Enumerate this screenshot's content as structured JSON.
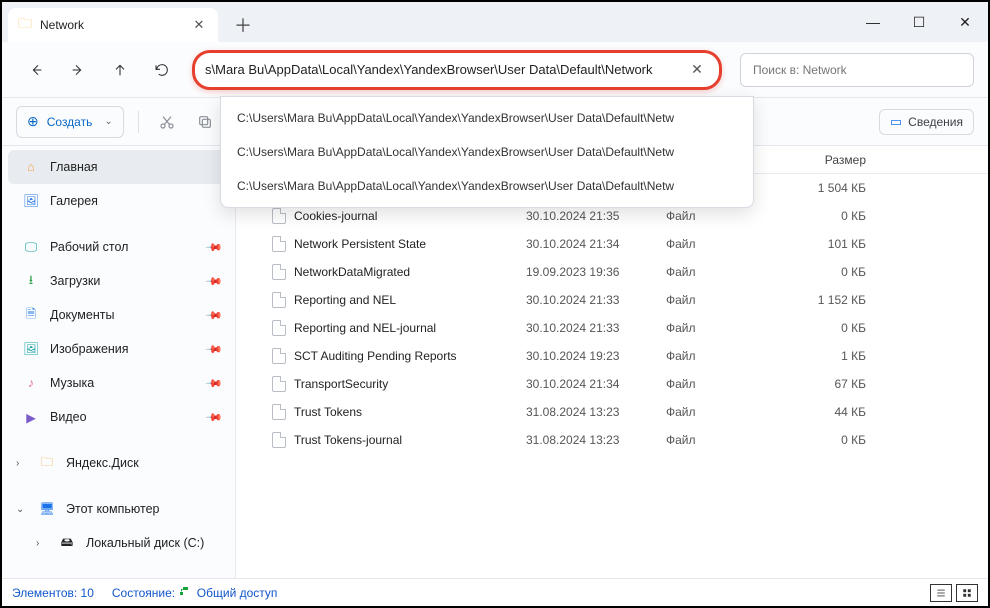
{
  "window": {
    "tab_title": "Network"
  },
  "nav": {
    "address_value": "s\\Mara Bu\\AppData\\Local\\Yandex\\YandexBrowser\\User Data\\Default\\Network",
    "search_placeholder": "Поиск в: Network"
  },
  "suggestions": [
    "C:\\Users\\Mara Bu\\AppData\\Local\\Yandex\\YandexBrowser\\User Data\\Default\\Netw",
    "C:\\Users\\Mara Bu\\AppData\\Local\\Yandex\\YandexBrowser\\User Data\\Default\\Netw",
    "C:\\Users\\Mara Bu\\AppData\\Local\\Yandex\\YandexBrowser\\User Data\\Default\\Netw"
  ],
  "toolbar": {
    "create_label": "Создать",
    "details_label": "Сведения"
  },
  "sidebar": {
    "home": "Главная",
    "gallery": "Галерея",
    "desktop": "Рабочий стол",
    "downloads": "Загрузки",
    "documents": "Документы",
    "pictures": "Изображения",
    "music": "Музыка",
    "videos": "Видео",
    "yadisk": "Яндекс.Диск",
    "thispc": "Этот компьютер",
    "cdrive": "Локальный диск (C:)"
  },
  "columns": {
    "size": "Размер"
  },
  "files": [
    {
      "size": "1 504 КБ"
    },
    {
      "name": "Cookies-journal",
      "date": "30.10.2024 21:35",
      "type": "Файл",
      "size": "0 КБ"
    },
    {
      "name": "Network Persistent State",
      "date": "30.10.2024 21:34",
      "type": "Файл",
      "size": "101 КБ"
    },
    {
      "name": "NetworkDataMigrated",
      "date": "19.09.2023 19:36",
      "type": "Файл",
      "size": "0 КБ"
    },
    {
      "name": "Reporting and NEL",
      "date": "30.10.2024 21:33",
      "type": "Файл",
      "size": "1 152 КБ"
    },
    {
      "name": "Reporting and NEL-journal",
      "date": "30.10.2024 21:33",
      "type": "Файл",
      "size": "0 КБ"
    },
    {
      "name": "SCT Auditing Pending Reports",
      "date": "30.10.2024 19:23",
      "type": "Файл",
      "size": "1 КБ"
    },
    {
      "name": "TransportSecurity",
      "date": "30.10.2024 21:34",
      "type": "Файл",
      "size": "67 КБ"
    },
    {
      "name": "Trust Tokens",
      "date": "31.08.2024 13:23",
      "type": "Файл",
      "size": "44 КБ"
    },
    {
      "name": "Trust Tokens-journal",
      "date": "31.08.2024 13:23",
      "type": "Файл",
      "size": "0 КБ"
    }
  ],
  "status": {
    "elements": "Элементов: 10",
    "state_label": "Состояние:",
    "shared": "Общий доступ"
  }
}
